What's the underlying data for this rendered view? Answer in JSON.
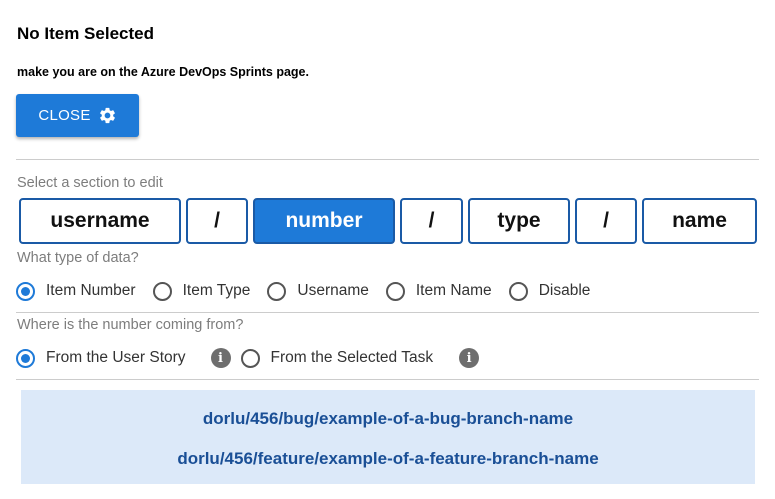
{
  "header": {
    "title": "No Item Selected",
    "subtitle": "make you are on the Azure DevOps Sprints page."
  },
  "close_button": {
    "label": "CLOSE",
    "icon": "gear-icon"
  },
  "segments_section": {
    "label": "Select a section to edit",
    "segments": [
      {
        "label": "username",
        "active": false
      },
      {
        "label": "/",
        "active": false
      },
      {
        "label": "number",
        "active": true
      },
      {
        "label": "/",
        "active": false
      },
      {
        "label": "type",
        "active": false
      },
      {
        "label": "/",
        "active": false
      },
      {
        "label": "name",
        "active": false
      }
    ]
  },
  "data_type": {
    "label": "What type of data?",
    "options": [
      {
        "label": "Item Number",
        "checked": true
      },
      {
        "label": "Item Type",
        "checked": false
      },
      {
        "label": "Username",
        "checked": false
      },
      {
        "label": "Item Name",
        "checked": false
      },
      {
        "label": "Disable",
        "checked": false
      }
    ]
  },
  "number_source": {
    "label": "Where is the number coming from?",
    "options": [
      {
        "label": "From the User Story",
        "checked": true,
        "info_icon": "info-icon"
      },
      {
        "label": "From the Selected Task",
        "checked": false,
        "info_icon": "info-icon"
      }
    ]
  },
  "preview": {
    "lines": [
      "dorlu/456/bug/example-of-a-bug-branch-name",
      "dorlu/456/feature/example-of-a-feature-branch-name"
    ]
  },
  "colors": {
    "accent": "#1e7ad8",
    "segment_border": "#1a5aa6",
    "preview_bg": "#dce9f9",
    "preview_text": "#1a4f96"
  }
}
